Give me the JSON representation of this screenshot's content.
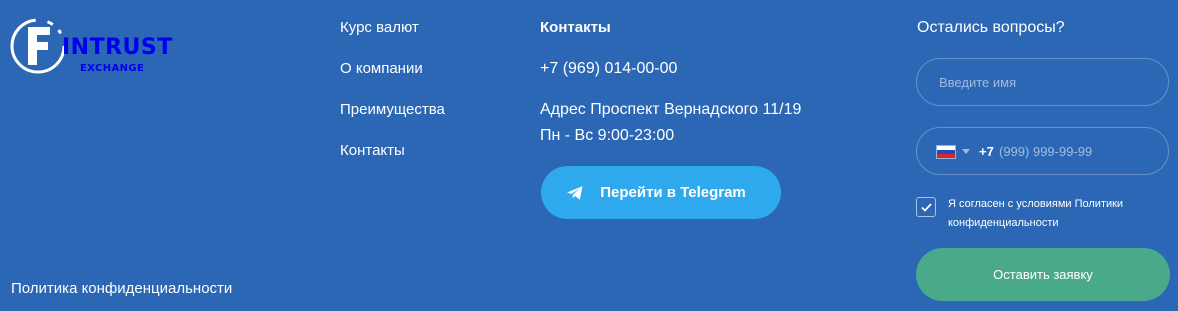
{
  "logo": {
    "word": "INTRUST",
    "sub": "EXCHANGE",
    "letter": "F"
  },
  "nav": {
    "items": [
      {
        "label": "Курс валют"
      },
      {
        "label": "О компании"
      },
      {
        "label": "Преимущества"
      },
      {
        "label": "Контакты"
      }
    ]
  },
  "contacts": {
    "heading": "Контакты",
    "phone": "+7 (969) 014-00-00",
    "address": "Адрес Проспект Вернадского 11/19",
    "hours": "Пн - Вс 9:00-23:00",
    "telegram_button": "Перейти в Telegram"
  },
  "privacy_link": "Политика конфиденциальности",
  "form": {
    "title": "Остались вопросы?",
    "name_placeholder": "Введите имя",
    "dial_code": "+7",
    "phone_placeholder": "(999) 999-99-99",
    "consent": "Я согласен с условиями Политики конфиденциальности",
    "consent_checked": true,
    "submit": "Оставить заявку"
  },
  "colors": {
    "background": "#2b67b4",
    "telegram_button": "#2fa9ee",
    "submit_button": "#4aa98a"
  },
  "icons": [
    "telegram-icon",
    "ru-flag-icon",
    "caret-down-icon",
    "checkmark-icon"
  ]
}
